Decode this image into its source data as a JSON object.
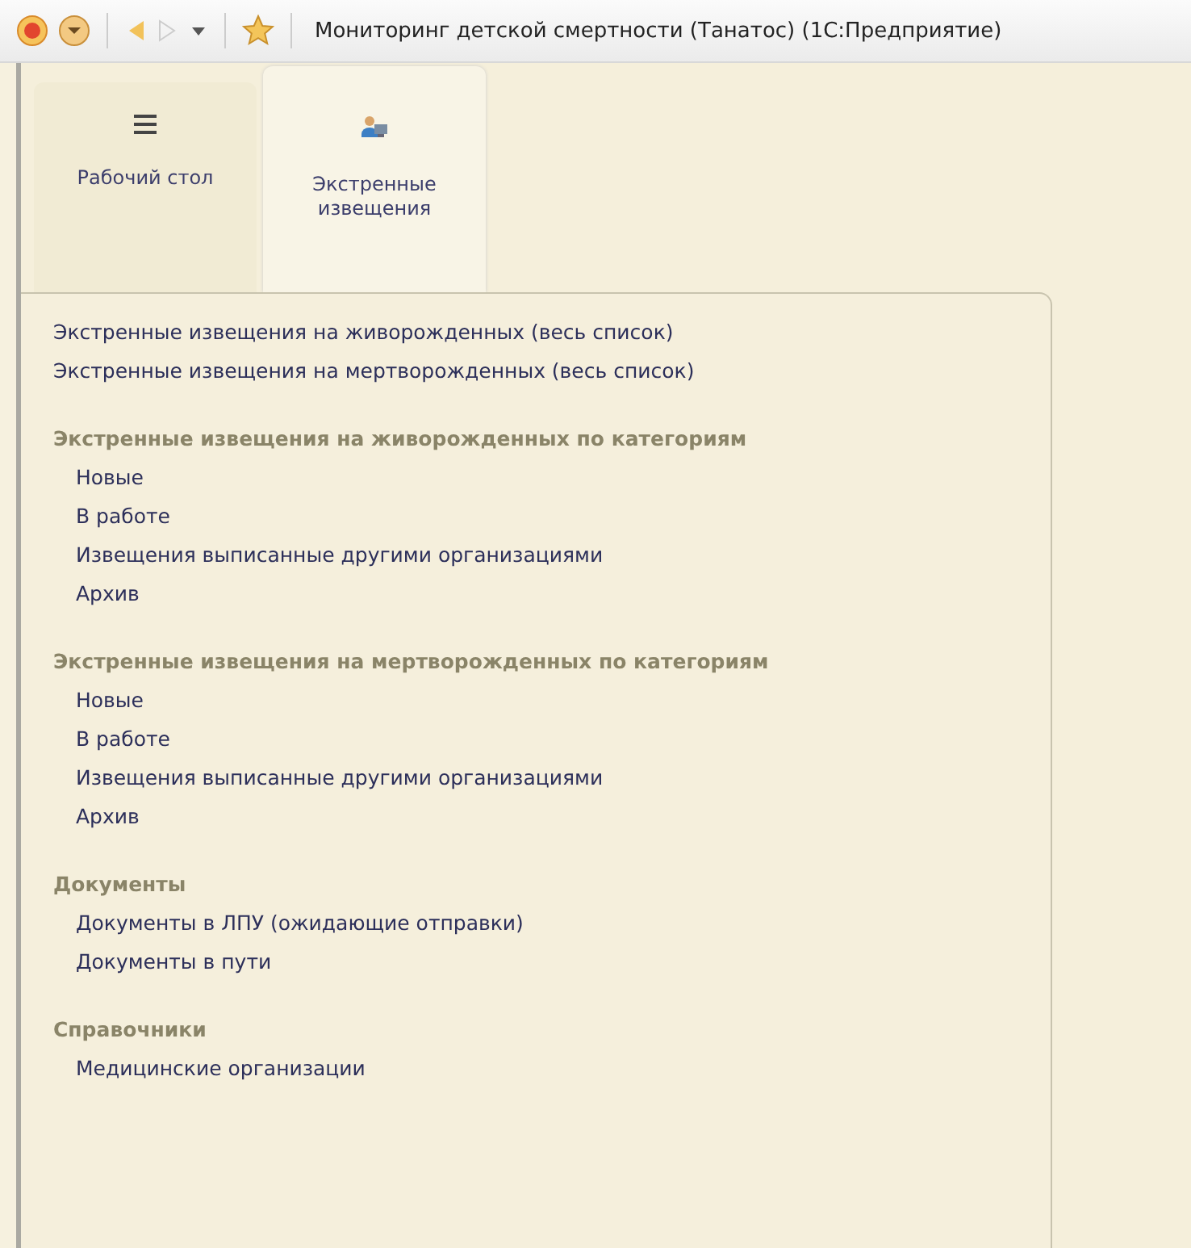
{
  "window": {
    "title": "Мониторинг детской смертности (Танатос)  (1С:Предприятие)"
  },
  "tabs": [
    {
      "label": "Рабочий стол",
      "kind": "menu",
      "selected": false
    },
    {
      "label": "Экстренные извещения",
      "kind": "people",
      "selected": true
    }
  ],
  "sections": [
    {
      "items": [
        "Экстренные извещения на живорожденных (весь список)",
        "Экстренные извещения на мертворожденных (весь список)"
      ]
    },
    {
      "heading": "Экстренные извещения на живорожденных по категориям",
      "items": [
        "Новые",
        "В работе",
        "Извещения выписанные другими организациями",
        "Архив"
      ]
    },
    {
      "heading": "Экстренные извещения на мертворожденных по категориям",
      "items": [
        "Новые",
        "В работе",
        "Извещения выписанные другими организациями",
        "Архив"
      ]
    },
    {
      "heading": "Документы",
      "items": [
        "Документы в ЛПУ (ожидающие отправки)",
        "Документы в пути"
      ]
    },
    {
      "heading": "Справочники",
      "items": [
        "Медицинские организации"
      ]
    }
  ]
}
